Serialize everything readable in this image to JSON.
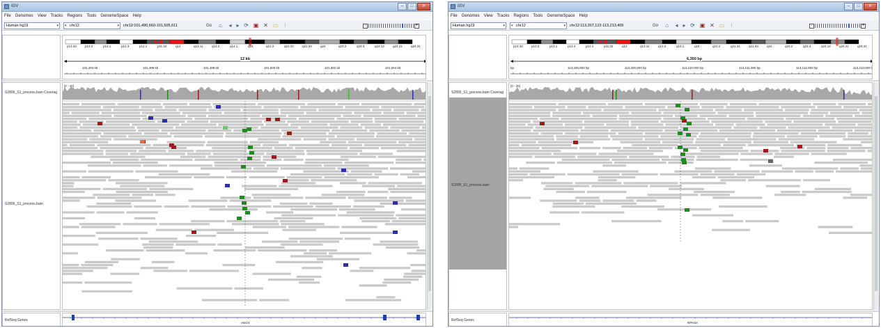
{
  "windows": [
    {
      "title": "IGV",
      "menu": [
        "File",
        "Genomes",
        "View",
        "Tracks",
        "Regions",
        "Tools",
        "GenomeSpace",
        "Help"
      ],
      "genome": "Human hg19",
      "chromosome": "chr12",
      "locus": "chr12:101,490,660-101,505,611",
      "ruler_span": "12 kb",
      "ruler_labels": [
        "101,494 kb",
        "101,496 kb",
        "101,498 kb",
        "101,500 kb",
        "101,502 kb",
        "101,504 kb"
      ],
      "coverage_range": "[0 - 40]",
      "tracks": {
        "coverage": "S2896_S1_process.bam Coverag",
        "alignment": "S2896_S1_process.bam",
        "gene": "RefSeq Genes"
      },
      "gene_name": "ANO4"
    },
    {
      "title": "IGV",
      "menu": [
        "File",
        "Genomes",
        "View",
        "Tracks",
        "Regions",
        "Tools",
        "GenomeSpace",
        "Help"
      ],
      "genome": "Human hg19",
      "chromosome": "chr12",
      "locus": "chr12:113,207,122-113,213,405",
      "ruler_span": "6,350 bp",
      "ruler_labels": [
        "bp",
        "113,208,000 bp",
        "113,209,000 bp",
        "113,210,000 bp",
        "113,211,000 bp",
        "113,212,000 bp",
        "113,213,000 bp"
      ],
      "coverage_range": "[0 - 35]",
      "tracks": {
        "coverage": "S2895_S1_process.bam Coverag",
        "alignment": "S2895_S1_process.bam",
        "gene": "RefSeq Genes"
      },
      "gene_name": "RPH3A"
    }
  ],
  "chr_band_labels": [
    "p13.33",
    "p13.2",
    "p13.1",
    "p12.3",
    "p12.1",
    "p11.22",
    "q12",
    "q13.11",
    "q13.2",
    "q14.1",
    "q15",
    "q21.2",
    "q21.31",
    "q21.33",
    "q22",
    "q23.2",
    "q23.3",
    "q24.12",
    "q24.21",
    "q24.31"
  ],
  "colors": {
    "read": "#c9c9c9",
    "mismatch_g": "#1a8f1a",
    "mismatch_t": "#a11a1a",
    "mismatch_c": "#2e2eaf",
    "mismatch_a": "#3cb83c",
    "coverage": "#a8a8a8",
    "gene": "#1f3fa8",
    "window_title_bg": "#b8cfe8"
  },
  "icons": [
    "home-icon",
    "back-icon",
    "forward-icon",
    "refresh-icon",
    "roi-icon",
    "close-icon",
    "popup-icon",
    "ruler-icon"
  ]
}
